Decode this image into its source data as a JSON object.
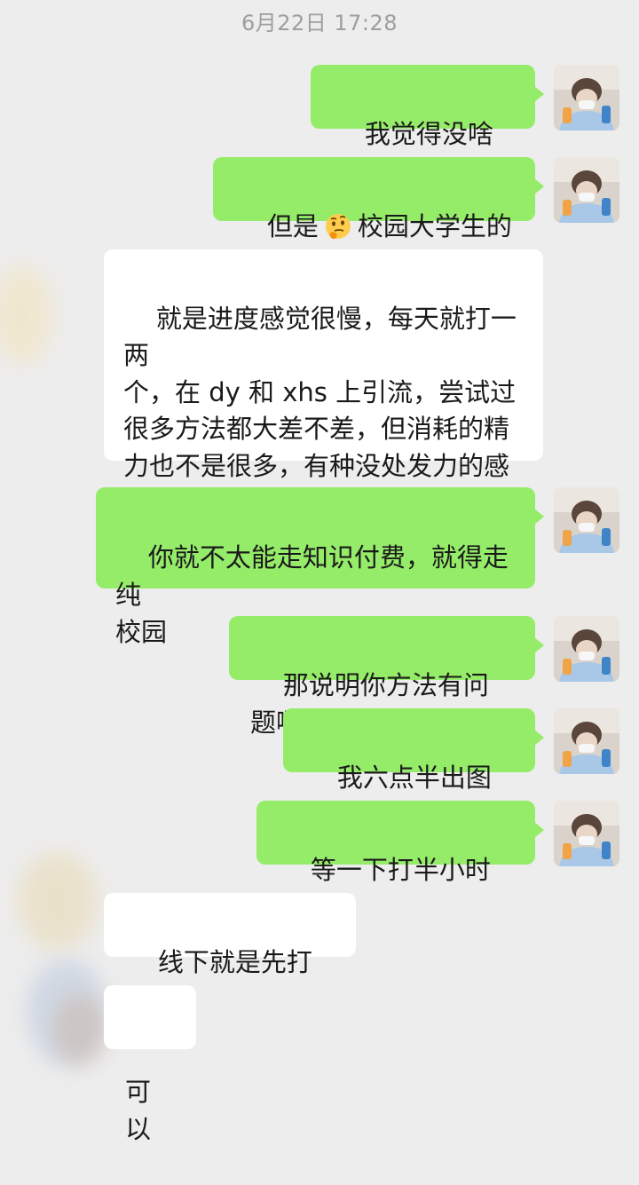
{
  "timestamp": "6月22日 17:28",
  "messages": [
    {
      "side": "out",
      "text": "我觉得没啥问题"
    },
    {
      "side": "out",
      "text_before": "但是",
      "emoji": "thinking-face",
      "text_after": "校园大学生的话"
    },
    {
      "side": "in",
      "text": "就是进度感觉很慢，每天就打一两\n个，在 dy 和 xhs 上引流，尝试过\n很多方法都大差不差，但消耗的精\n力也不是很多，有种没处发力的感\n觉"
    },
    {
      "side": "out",
      "text": "你就不太能走知识付费，就得走纯\n校园"
    },
    {
      "side": "out",
      "text": "那说明你方法有问题啊"
    },
    {
      "side": "out",
      "text": "我六点半出图书馆"
    },
    {
      "side": "out",
      "text": "等一下打半小时电话"
    },
    {
      "side": "in",
      "text": "线下就是先打流量"
    },
    {
      "side": "in",
      "text": "可以"
    }
  ],
  "colors": {
    "background": "#ededed",
    "outgoing_bubble": "#95ec69",
    "incoming_bubble": "#ffffff",
    "timestamp": "#9e9e9e"
  }
}
